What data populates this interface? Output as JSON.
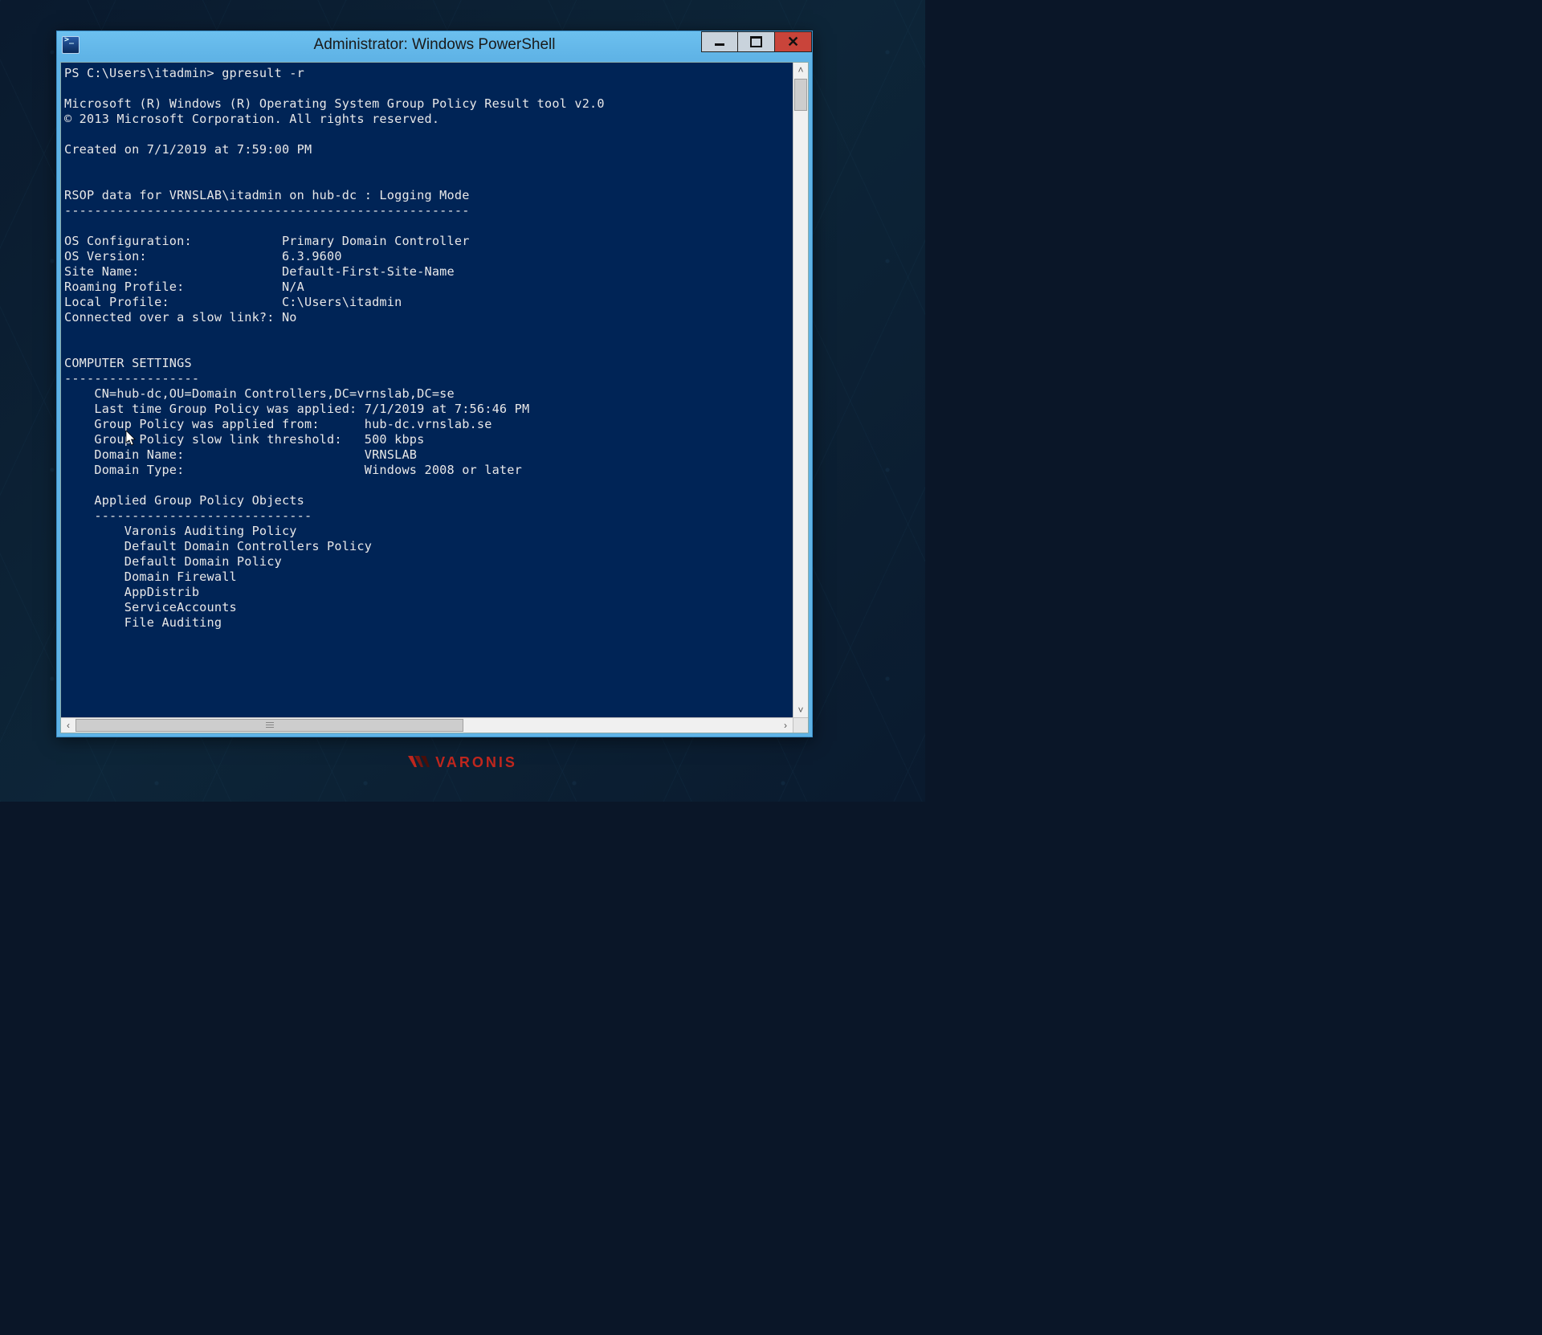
{
  "window": {
    "title": "Administrator: Windows PowerShell"
  },
  "console": {
    "prompt": "PS C:\\Users\\itadmin> ",
    "command": "gpresult -r",
    "header_line1": "Microsoft (R) Windows (R) Operating System Group Policy Result tool v2.0",
    "header_line2": "© 2013 Microsoft Corporation. All rights reserved.",
    "created_line": "Created on 7/1/2019 at 7:59:00 PM",
    "rsop_line": "RSOP data for VRNSLAB\\itadmin on hub-dc : Logging Mode",
    "rsop_divider": "------------------------------------------------------",
    "info": {
      "os_configuration_label": "OS Configuration:",
      "os_configuration_value": "Primary Domain Controller",
      "os_version_label": "OS Version:",
      "os_version_value": "6.3.9600",
      "site_name_label": "Site Name:",
      "site_name_value": "Default-First-Site-Name",
      "roaming_profile_label": "Roaming Profile:",
      "roaming_profile_value": "N/A",
      "local_profile_label": "Local Profile:",
      "local_profile_value": "C:\\Users\\itadmin",
      "slow_link_label": "Connected over a slow link?:",
      "slow_link_value": "No"
    },
    "computer_settings_header": "COMPUTER SETTINGS",
    "computer_settings_divider": "------------------",
    "computer_settings": {
      "cn_line": "CN=hub-dc,OU=Domain Controllers,DC=vrnslab,DC=se",
      "last_applied": "Last time Group Policy was applied: 7/1/2019 at 7:56:46 PM",
      "applied_from_label": "Group Policy was applied from:",
      "applied_from_value": "hub-dc.vrnslab.se",
      "slow_threshold_label": "Group Policy slow link threshold:",
      "slow_threshold_value": "500 kbps",
      "domain_name_label": "Domain Name:",
      "domain_name_value": "VRNSLAB",
      "domain_type_label": "Domain Type:",
      "domain_type_value": "Windows 2008 or later"
    },
    "applied_gpo_header": "Applied Group Policy Objects",
    "applied_gpo_divider": "-----------------------------",
    "applied_gpos": [
      "Varonis Auditing Policy",
      "Default Domain Controllers Policy",
      "Default Domain Policy",
      "Domain Firewall",
      "AppDistrib",
      "ServiceAccounts",
      "File Auditing"
    ]
  },
  "brand": {
    "text": "VARONIS"
  }
}
